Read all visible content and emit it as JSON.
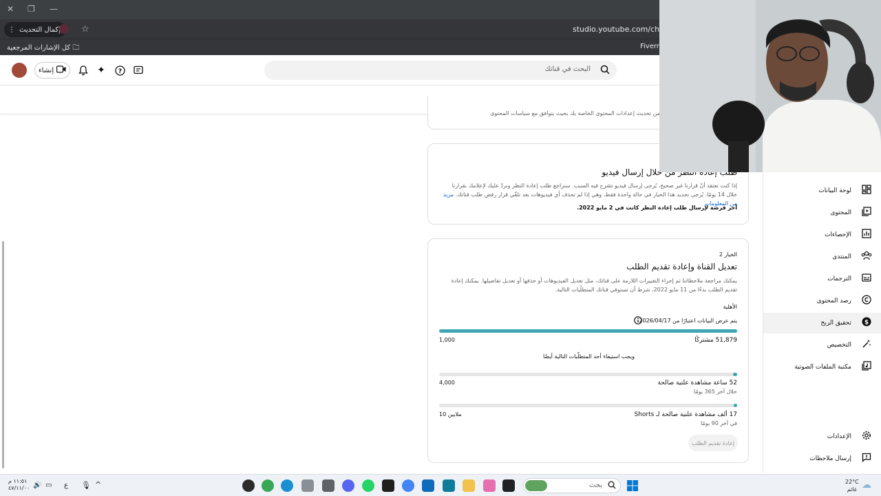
{
  "browser": {
    "update_button": "إكمال التحديث",
    "url": "studio.youtube.com/channel/U",
    "bookmarks_all": "كل الإشارات المرجعية",
    "bookmark_fiverr": "Fiverr - "
  },
  "header": {
    "search_placeholder": "البحث في قناتك",
    "create_label": "إنشاء"
  },
  "top_stub": {
    "text": "...سبب واضح ودقيق، وقد تتمكن من تحديث إعدادات المحتوى الخاصة بك بحيث يتوافق مع سياسات المحتوى"
  },
  "card1": {
    "title": "طلب إعادة النظر من خلال إرسال فيديو",
    "body": "إذا كنت تعتقد أنّ قرارنا غير صحيح، يُرجى إرسال فيديو تشرح فيه السبب. سنراجع طلب إعادة النظر ونردّ عليك لإعلامك بقرارنا خلال 14 يومًا. يُرجى تحديد هذا الخيار في حالة واحدة فقط، وهي إذا لم تحذف أي فيديوهات بعد تلقّي قرار رفض طلب قناتك.",
    "link": "مزيد من المعلومات",
    "deadline": "آخر فرصة لإرسال طلب إعادة النظر كانت في 2 مايو 2022."
  },
  "card2": {
    "option_label": "الخيار 2",
    "title": "تعديل القناة وإعادة تقديم الطلب",
    "body": "يمكنك مراجعة ملاحظاتنا ثم إجراء التغييرات اللازمة على قناتك، مثل تعديل الفيديوهات أو حذفها أو تعديل تفاصيلها. يمكنك إعادة تقديم الطلب بدءًا من 11 مايو 2022، شرط أن تستوفي قناتك المتطلّبات التالية.",
    "eligibility": "الأهلية",
    "data_note": "يتم عرض البيانات اعتبارًا من 2026/04/17.",
    "subs_value": "51,879 مشتركًا",
    "subs_target": "1,000",
    "subs_progress": 1.0,
    "also_required": "ويجب استيفاء أحد المتطلّبات التالية أيضًا",
    "hours_value": "52 ساعة مشاهدة علنية صالحة",
    "hours_period": "خلال آخر 365 يومًا",
    "hours_target": "4,000",
    "hours_progress": 0.013,
    "shorts_value": "17 ألف مشاهدة علنية صالحة لـ Shorts",
    "shorts_period": "في آخر 90 يومًا",
    "shorts_target": "10 ملايين",
    "shorts_progress": 0.0017,
    "resubmit": "إعادة تقديم الطلب"
  },
  "nav": [
    {
      "label": "لوحة البيانات",
      "icon": "dashboard-icon"
    },
    {
      "label": "المحتوى",
      "icon": "content-icon"
    },
    {
      "label": "الإحصاءات",
      "icon": "analytics-icon"
    },
    {
      "label": "المنتدى",
      "icon": "community-icon"
    },
    {
      "label": "الترجمات",
      "icon": "subtitles-icon"
    },
    {
      "label": "رصد المحتوى",
      "icon": "copyright-icon"
    },
    {
      "label": "تحقيق الربح",
      "icon": "earn-icon"
    },
    {
      "label": "التخصيص",
      "icon": "customization-icon"
    },
    {
      "label": "مكتبة الملفات الصوتية",
      "icon": "audio-library-icon"
    },
    {
      "label": "الإعدادات",
      "icon": "settings-icon"
    },
    {
      "label": "إرسال ملاحظات",
      "icon": "feedback-icon"
    }
  ],
  "taskbar": {
    "search": "بحث",
    "time": "١١:٥١ م",
    "date": "٤٧/١١/٠٠",
    "weather_temp": "22°C",
    "weather_desc": "غائم",
    "lang": "ع"
  },
  "colors": {
    "progress": "#3ea6b4",
    "link": "#065fd4"
  }
}
